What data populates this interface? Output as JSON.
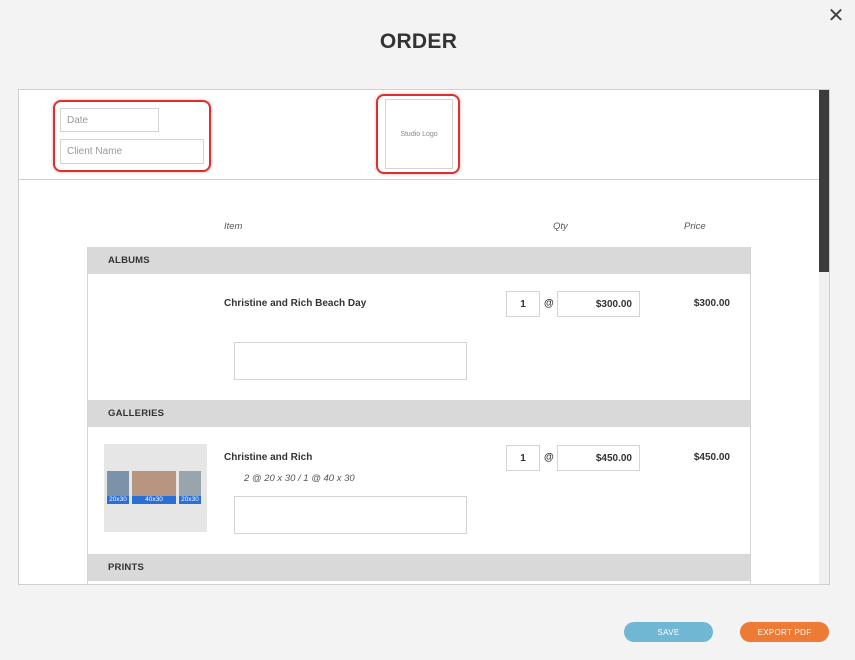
{
  "dialog": {
    "title": "ORDER",
    "close_glyph": "✕"
  },
  "header": {
    "date_placeholder": "Date",
    "client_placeholder": "Client Name",
    "logo_text": "Studio Logo"
  },
  "columns": {
    "item": "Item",
    "qty": "Qty",
    "price": "Price"
  },
  "sections": [
    {
      "title": "ALBUMS",
      "items": [
        {
          "name": "Christine and Rich Beach Day",
          "qty": "1",
          "at": "@",
          "unit_price": "$300.00",
          "total": "$300.00"
        }
      ]
    },
    {
      "title": "GALLERIES",
      "items": [
        {
          "name": "Christine and Rich",
          "sizes": "2 @ 20 x 30 / 1 @ 40 x 30",
          "qty": "1",
          "at": "@",
          "unit_price": "$450.00",
          "total": "$450.00",
          "thumb_labels": [
            "20x30",
            "40x30",
            "20x30"
          ]
        }
      ]
    },
    {
      "title": "PRINTS",
      "items": []
    }
  ],
  "footer": {
    "save_label": "SAVE",
    "export_label": "EXPORT PDF"
  },
  "colors": {
    "save": "#6fb7d3",
    "export": "#ed7a35",
    "highlight": "#d93030",
    "section_bg": "#d9d9d9"
  },
  "icons": {
    "close": "close-icon"
  }
}
